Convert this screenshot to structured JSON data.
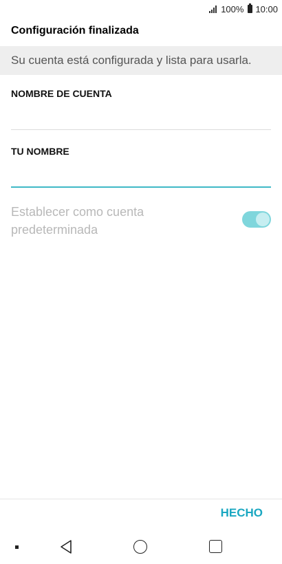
{
  "status_bar": {
    "battery": "100%",
    "time": "10:00"
  },
  "header": {
    "title": "Configuración finalizada"
  },
  "banner": {
    "message": "Su cuenta está configurada y lista para usarla."
  },
  "fields": {
    "account_name": {
      "label": "NOMBRE DE CUENTA",
      "value": ""
    },
    "your_name": {
      "label": "TU NOMBRE",
      "value": ""
    }
  },
  "default_account": {
    "label": "Establecer como cuenta predeterminada",
    "enabled": true
  },
  "actions": {
    "done_label": "HECHO"
  },
  "colors": {
    "accent": "#1aa7c1",
    "toggle_track": "#7fd6dc",
    "active_underline": "#3fb8c6"
  }
}
